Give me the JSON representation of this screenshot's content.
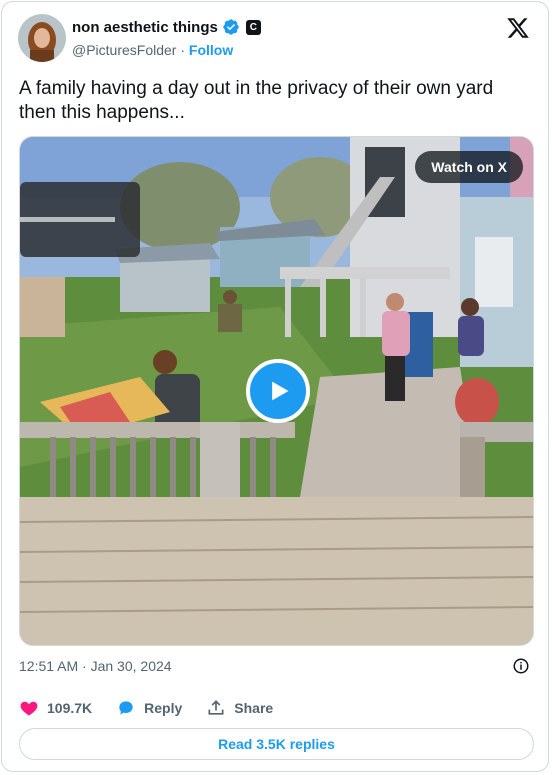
{
  "author": {
    "name": "non aesthetic things",
    "handle": "@PicturesFolder",
    "separator": "·",
    "follow_label": "Follow",
    "affiliate_badge": "C"
  },
  "tweet": {
    "text": "A family having a day out in the privacy of their own yard then this happens..."
  },
  "media": {
    "watch_label": "Watch on X"
  },
  "meta": {
    "timestamp": "12:51 AM · Jan 30, 2024"
  },
  "actions": {
    "likes": "109.7K",
    "reply_label": "Reply",
    "share_label": "Share"
  },
  "replies_button": "Read 3.5K replies",
  "colors": {
    "accent": "#1d9bf0",
    "like": "#f91880",
    "text": "#0f1419",
    "muted": "#536471"
  }
}
